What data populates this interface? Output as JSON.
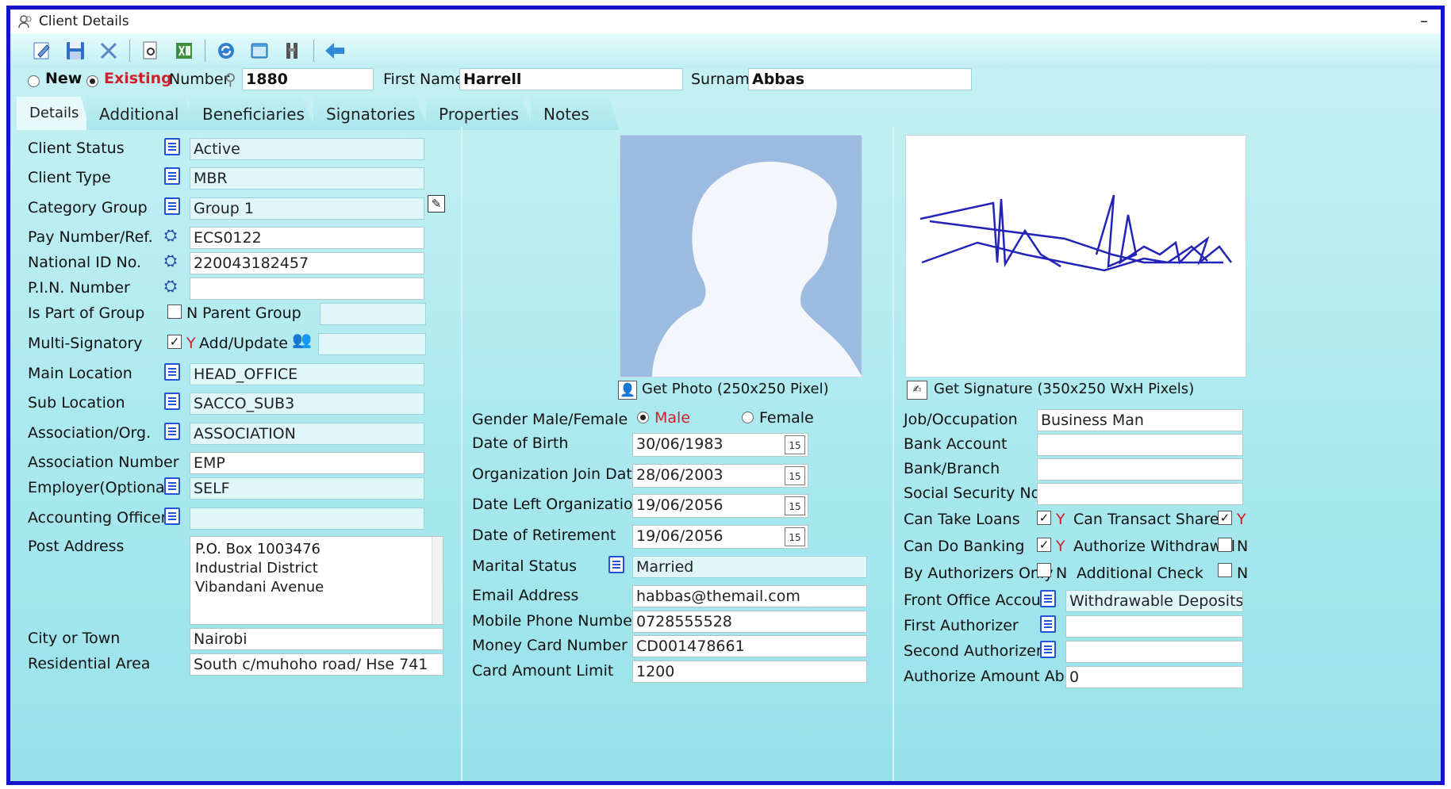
{
  "window": {
    "title": "Client Details",
    "minimize": "–"
  },
  "toolbar": {
    "icons": [
      "edit-icon",
      "save-icon",
      "delete-icon",
      "preview-icon",
      "excel-icon",
      "refresh-icon",
      "window-icon",
      "filter-icon",
      "back-arrow-icon"
    ]
  },
  "record": {
    "new_label": "New",
    "existing_label": "Existing",
    "number_label": "Number",
    "number": "1880",
    "first_names_label": "First Names",
    "first_names": "Harrell",
    "surname_label": "Surname",
    "surname": "Abbas"
  },
  "tabs": [
    "Details",
    "Additional",
    "Beneficiaries",
    "Signatories",
    "Properties",
    "Notes"
  ],
  "left": {
    "client_status": {
      "label": "Client Status",
      "value": "Active"
    },
    "client_type": {
      "label": "Client Type",
      "value": "MBR"
    },
    "category_group": {
      "label": "Category Group",
      "value": "Group 1"
    },
    "pay_number": {
      "label": "Pay Number/Ref.",
      "value": "ECS0122"
    },
    "national_id": {
      "label": "National ID No.",
      "value": "220043182457"
    },
    "pin": {
      "label": "P.I.N. Number",
      "value": ""
    },
    "part_of_group": {
      "label": "Is Part of Group",
      "flag": "N",
      "parent_label": "Parent Group",
      "parent_value": ""
    },
    "multi_signatory": {
      "label": "Multi-Signatory",
      "flag": "Y",
      "add_update": "Add/Update",
      "value": ""
    },
    "main_location": {
      "label": "Main Location",
      "value": "HEAD_OFFICE"
    },
    "sub_location": {
      "label": "Sub Location",
      "value": "SACCO_SUB3"
    },
    "association": {
      "label": "Association/Org.",
      "value": "ASSOCIATION"
    },
    "association_number": {
      "label": "Association Number",
      "value": "EMP"
    },
    "employer": {
      "label": "Employer(Optional)",
      "value": "SELF"
    },
    "accounting_officer": {
      "label": "Accounting Officer",
      "value": ""
    },
    "post_address": {
      "label": "Post Address",
      "line1": "P.O. Box 1003476",
      "line2": "Industrial District",
      "line3": "Vibandani Avenue"
    },
    "city": {
      "label": "City or Town",
      "value": "Nairobi"
    },
    "residential": {
      "label": "Residential Area",
      "value": "South c/muhoho road/ Hse 741"
    }
  },
  "middle": {
    "get_photo": "Get  Photo (250x250 Pixel)",
    "gender": {
      "label": "Gender Male/Female",
      "male": "Male",
      "female": "Female",
      "selected": "Male"
    },
    "dob": {
      "label": "Date of Birth",
      "value": "30/06/1983"
    },
    "join_date": {
      "label": "Organization Join Date",
      "value": "28/06/2003"
    },
    "left_date": {
      "label": "Date Left Organization",
      "value": "19/06/2056"
    },
    "retirement": {
      "label": "Date of Retirement",
      "value": "19/06/2056"
    },
    "calendar_day": "15",
    "marital": {
      "label": "Marital Status",
      "value": "Married"
    },
    "email": {
      "label": "Email Address",
      "value": "habbas@themail.com"
    },
    "mobile": {
      "label": "Mobile Phone Number",
      "value": "0728555528"
    },
    "money_card": {
      "label": "Money Card Number",
      "value": "CD001478661"
    },
    "card_limit": {
      "label": "Card Amount Limit",
      "value": "1200"
    }
  },
  "right": {
    "get_signature": "Get Signature (350x250 WxH Pixels)",
    "job": {
      "label": "Job/Occupation",
      "value": "Business Man"
    },
    "bank_account": {
      "label": "Bank Account",
      "value": ""
    },
    "bank_branch": {
      "label": "Bank/Branch",
      "value": ""
    },
    "social_security": {
      "label": "Social Security No.",
      "value": ""
    },
    "can_take_loans": {
      "label": "Can Take Loans",
      "flag": "Y"
    },
    "can_transact": {
      "label": "Can Transact Shares",
      "flag": "Y"
    },
    "can_bank": {
      "label": "Can Do Banking",
      "flag": "Y"
    },
    "auth_withdrawal": {
      "label": "Authorize Withdrawal",
      "flag": "N"
    },
    "by_authorizers": {
      "label": "By Authorizers Only",
      "flag": "N"
    },
    "additional_check": {
      "label": "Additional Check",
      "flag": "N"
    },
    "front_office": {
      "label": "Front Office Account",
      "value": "Withdrawable Deposits"
    },
    "first_auth": {
      "label": "First Authorizer",
      "value": ""
    },
    "second_auth": {
      "label": "Second Authorizer",
      "value": ""
    },
    "auth_amount": {
      "label": "Authorize Amount Above",
      "value": "0"
    }
  },
  "colors": {
    "frame": "#1414c8",
    "accent_red": "#d0202a",
    "panel": "#a8e8ee"
  }
}
